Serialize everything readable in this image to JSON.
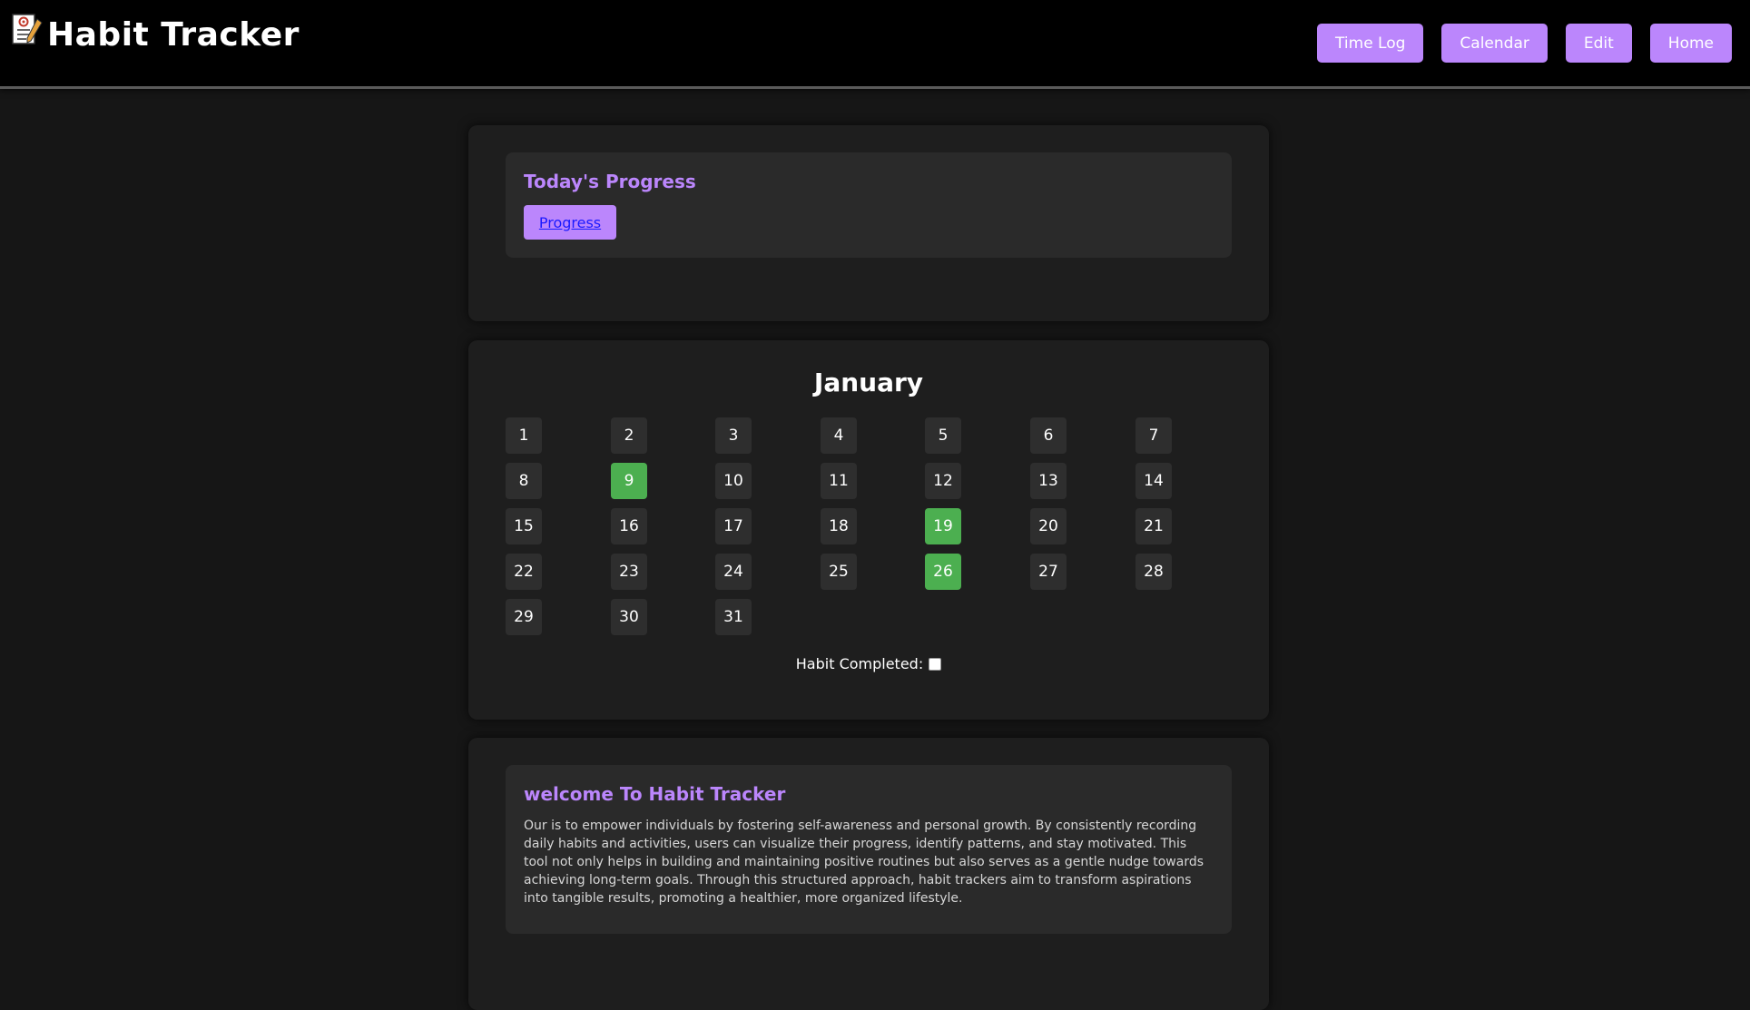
{
  "header": {
    "title": "Habit Tracker",
    "logo_icon": "notepad-pencil-icon",
    "nav": [
      {
        "label": "Time Log"
      },
      {
        "label": "Calendar"
      },
      {
        "label": "Edit"
      },
      {
        "label": "Home"
      }
    ]
  },
  "progress": {
    "title": "Today's Progress",
    "button_label": "Progress"
  },
  "calendar": {
    "month": "January",
    "days": [
      "1",
      "2",
      "3",
      "4",
      "5",
      "6",
      "7",
      "8",
      "9",
      "10",
      "11",
      "12",
      "13",
      "14",
      "15",
      "16",
      "17",
      "18",
      "19",
      "20",
      "21",
      "22",
      "23",
      "24",
      "25",
      "26",
      "27",
      "28",
      "29",
      "30",
      "31"
    ],
    "completed_days": [
      "9",
      "19",
      "26"
    ],
    "habit_label": "Habit Completed:",
    "habit_checked": false
  },
  "welcome": {
    "title": "welcome To Habit Tracker",
    "text": "Our is to empower individuals by fostering self-awareness and personal growth. By consistently recording daily habits and activities, users can visualize their progress, identify patterns, and stay motivated. This tool not only helps in building and maintaining positive routines but also serves as a gentle nudge towards achieving long-term goals. Through this structured approach, habit trackers aim to transform aspirations into tangible results, promoting a healthier, more organized lifestyle."
  },
  "colors": {
    "accent": "#bb86fc",
    "completed": "#4caf50",
    "background": "#161616",
    "card": "#1e1e1e"
  }
}
